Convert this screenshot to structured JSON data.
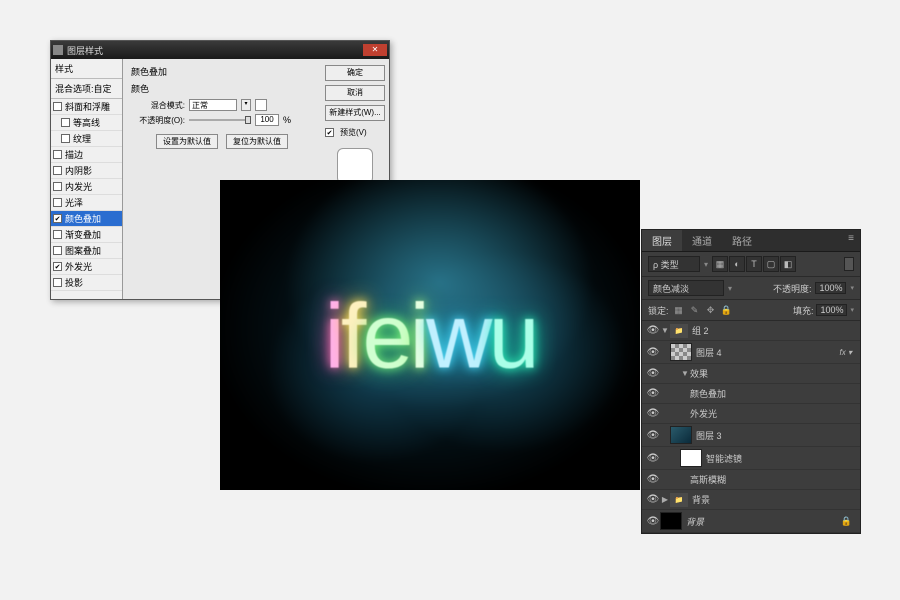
{
  "layer_style": {
    "title": "图层样式",
    "sidebar": {
      "header1": "样式",
      "header2": "混合选项:自定",
      "items": [
        {
          "label": "斜面和浮雕",
          "checked": false
        },
        {
          "label": "等高线",
          "checked": false,
          "indent": true
        },
        {
          "label": "纹理",
          "checked": false,
          "indent": true
        },
        {
          "label": "描边",
          "checked": false
        },
        {
          "label": "内阴影",
          "checked": false
        },
        {
          "label": "内发光",
          "checked": false
        },
        {
          "label": "光泽",
          "checked": false
        },
        {
          "label": "颜色叠加",
          "checked": true,
          "selected": true
        },
        {
          "label": "渐变叠加",
          "checked": false
        },
        {
          "label": "图案叠加",
          "checked": false
        },
        {
          "label": "外发光",
          "checked": true
        },
        {
          "label": "投影",
          "checked": false
        }
      ]
    },
    "main": {
      "section_title": "颜色叠加",
      "group_title": "颜色",
      "blend_label": "混合模式:",
      "blend_value": "正常",
      "opacity_label": "不透明度(O):",
      "opacity_value": "100",
      "opacity_unit": "%",
      "default_btn": "设置为默认值",
      "reset_btn": "复位为默认值"
    },
    "right": {
      "ok": "确定",
      "cancel": "取消",
      "new_style": "新建样式(W)...",
      "preview_label": "预览(V)",
      "preview_checked": true
    }
  },
  "canvas_text": {
    "c1": "i",
    "c2": "f",
    "c3": "e",
    "c4": "i",
    "c5": "w",
    "c6": "u"
  },
  "layers_panel": {
    "tabs": {
      "layers": "图层",
      "channels": "通道",
      "paths": "路径"
    },
    "kind_label": "ρ 类型",
    "filter_icons": [
      "▦",
      "◐",
      "T",
      "▢",
      "◧"
    ],
    "blend_mode": "颜色减淡",
    "opacity_label": "不透明度:",
    "opacity_value": "100%",
    "lock_label": "锁定:",
    "lock_icons": [
      "▦",
      "✎",
      "✥",
      "🔒"
    ],
    "fill_label": "填充:",
    "fill_value": "100%",
    "items": [
      {
        "type": "group",
        "name": "组 2",
        "expanded": true,
        "eye": true
      },
      {
        "type": "layer",
        "name": "图层 4",
        "thumb": "checker",
        "eye": true,
        "fx": true,
        "indent": 1
      },
      {
        "type": "fx-header",
        "name": "效果",
        "eye": true,
        "indent": 2
      },
      {
        "type": "fx",
        "name": "颜色叠加",
        "eye": true,
        "indent": 3
      },
      {
        "type": "fx",
        "name": "外发光",
        "eye": true,
        "indent": 3
      },
      {
        "type": "layer",
        "name": "图层 3",
        "thumb": "group2",
        "eye": true,
        "indent": 1
      },
      {
        "type": "smart-header",
        "name": "智能滤镜",
        "thumb": "white",
        "eye": true,
        "indent": 2
      },
      {
        "type": "fx",
        "name": "高斯模糊",
        "eye": true,
        "indent": 3
      },
      {
        "type": "group",
        "name": "背景",
        "expanded": false,
        "eye": true
      },
      {
        "type": "layer",
        "name": "背景",
        "thumb": "black",
        "eye": true,
        "locked": true,
        "italic": true
      }
    ]
  }
}
